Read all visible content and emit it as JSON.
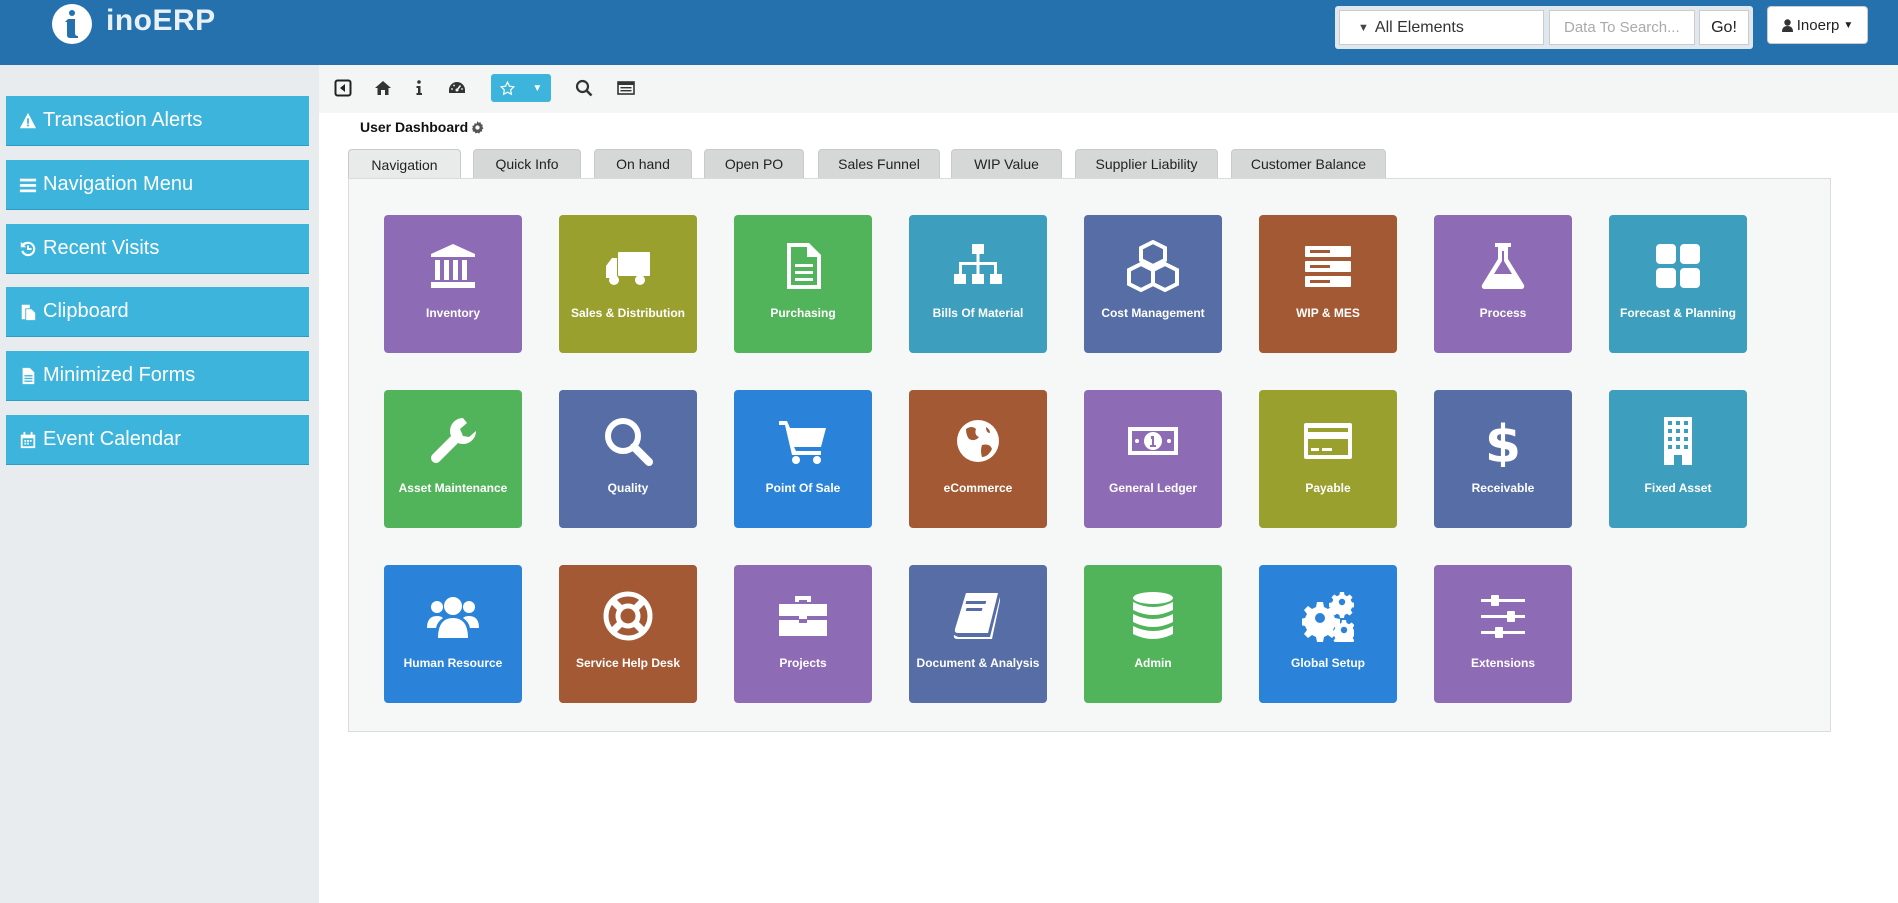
{
  "header": {
    "app_name": "inoERP",
    "search_scope": "All Elements",
    "search_placeholder": "Data To Search...",
    "go_label": "Go!",
    "user_label": "Inoerp"
  },
  "sidebar": {
    "items": [
      {
        "label": "Transaction Alerts",
        "icon": "warning-icon"
      },
      {
        "label": "Navigation Menu",
        "icon": "bars-icon"
      },
      {
        "label": "Recent Visits",
        "icon": "history-icon"
      },
      {
        "label": "Clipboard",
        "icon": "clipboard-icon"
      },
      {
        "label": "Minimized Forms",
        "icon": "file-icon"
      },
      {
        "label": "Event Calendar",
        "icon": "calendar-icon"
      }
    ]
  },
  "toolbar": {
    "icons": [
      "collapse-icon",
      "home-icon",
      "info-icon",
      "dashboard-icon",
      "star-icon",
      "caret-down-icon",
      "search-icon",
      "form-icon"
    ]
  },
  "dashboard": {
    "title": "User Dashboard",
    "tabs": [
      "Navigation",
      "Quick Info",
      "On hand",
      "Open PO",
      "Sales Funnel",
      "WIP Value",
      "Supplier Liability",
      "Customer Balance"
    ],
    "active_tab": "Navigation",
    "tiles": [
      {
        "label": "Inventory",
        "icon": "bank-icon",
        "color": "#8e6cb5"
      },
      {
        "label": "Sales & Distribution",
        "icon": "truck-icon",
        "color": "#9aa02e"
      },
      {
        "label": "Purchasing",
        "icon": "document-icon",
        "color": "#52b45a"
      },
      {
        "label": "Bills Of Material",
        "icon": "sitemap-icon",
        "color": "#3d9ebd"
      },
      {
        "label": "Cost Management",
        "icon": "cubes-icon",
        "color": "#566da6"
      },
      {
        "label": "WIP & MES",
        "icon": "server-icon",
        "color": "#a35a34"
      },
      {
        "label": "Process",
        "icon": "flask-icon",
        "color": "#8e6cb5"
      },
      {
        "label": "Forecast & Planning",
        "icon": "grid-icon",
        "color": "#3d9ebd"
      },
      {
        "label": "Asset Maintenance",
        "icon": "wrench-icon",
        "color": "#52b45a"
      },
      {
        "label": "Quality",
        "icon": "magnifier-icon",
        "color": "#566da6"
      },
      {
        "label": "Point Of Sale",
        "icon": "cart-icon",
        "color": "#2a83d8"
      },
      {
        "label": "eCommerce",
        "icon": "globe-icon",
        "color": "#a35a34"
      },
      {
        "label": "General Ledger",
        "icon": "money-icon",
        "color": "#8e6cb5"
      },
      {
        "label": "Payable",
        "icon": "credit-card-icon",
        "color": "#9aa02e"
      },
      {
        "label": "Receivable",
        "icon": "dollar-icon",
        "color": "#566da6"
      },
      {
        "label": "Fixed Asset",
        "icon": "building-icon",
        "color": "#3d9ebd"
      },
      {
        "label": "Human Resource",
        "icon": "users-icon",
        "color": "#2a83d8"
      },
      {
        "label": "Service Help Desk",
        "icon": "lifebuoy-icon",
        "color": "#a35a34"
      },
      {
        "label": "Projects",
        "icon": "briefcase-icon",
        "color": "#8e6cb5"
      },
      {
        "label": "Document & Analysis",
        "icon": "book-icon",
        "color": "#566da6"
      },
      {
        "label": "Admin",
        "icon": "database-icon",
        "color": "#52b45a"
      },
      {
        "label": "Global Setup",
        "icon": "gears-icon",
        "color": "#2a83d8"
      },
      {
        "label": "Extensions",
        "icon": "sliders-icon",
        "color": "#8e6cb5"
      }
    ]
  }
}
